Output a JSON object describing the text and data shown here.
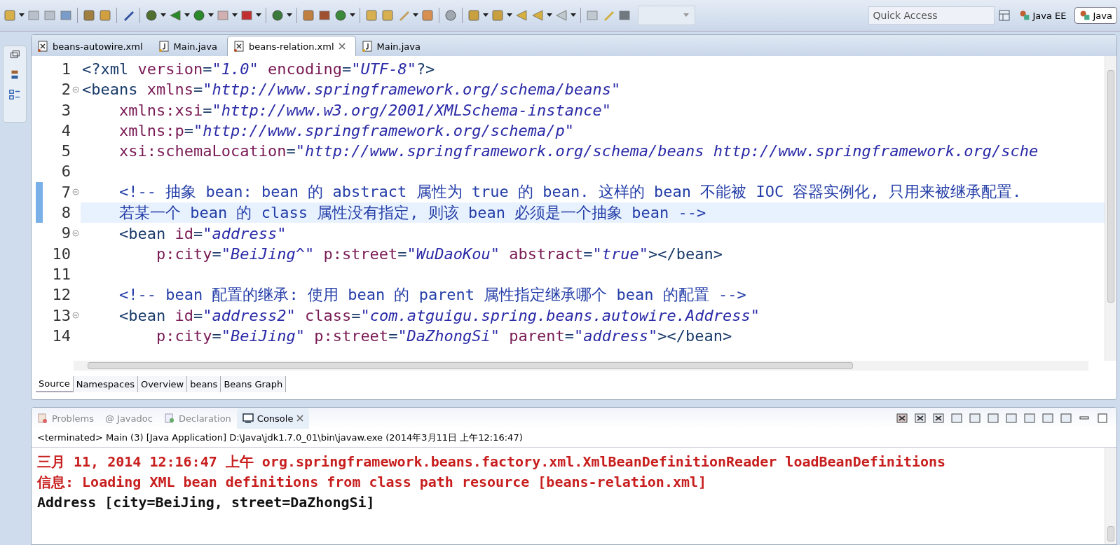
{
  "toolbar": {
    "quick_access": {
      "placeholder": "Quick Access"
    },
    "perspectives": [
      {
        "label": "Java EE",
        "selected": false
      },
      {
        "label": "Java",
        "selected": true
      }
    ]
  },
  "editor_tabs": [
    {
      "label": "beans-autowire.xml",
      "kind": "xml",
      "selected": false,
      "closable": false
    },
    {
      "label": "Main.java",
      "kind": "java",
      "selected": false,
      "closable": false
    },
    {
      "label": "beans-relation.xml",
      "kind": "xml",
      "selected": true,
      "closable": true
    },
    {
      "label": "Main.java",
      "kind": "java",
      "selected": false,
      "closable": false
    }
  ],
  "code_lines": [
    {
      "number": "1",
      "fold": false,
      "marked": false,
      "current": false,
      "tokens": [
        {
          "kind": "tag",
          "text": "<?xml"
        },
        {
          "kind": "attr",
          "text": " version"
        },
        {
          "kind": "tag",
          "text": "="
        },
        {
          "kind": "value",
          "text": "\"1.0\""
        },
        {
          "kind": "attr",
          "text": " encoding"
        },
        {
          "kind": "tag",
          "text": "="
        },
        {
          "kind": "value",
          "text": "\"UTF-8\""
        },
        {
          "kind": "tag",
          "text": "?>"
        }
      ]
    },
    {
      "number": "2",
      "fold": true,
      "marked": false,
      "current": false,
      "tokens": [
        {
          "kind": "tag",
          "text": "<beans"
        },
        {
          "kind": "attr",
          "text": " xmlns"
        },
        {
          "kind": "tag",
          "text": "="
        },
        {
          "kind": "value",
          "text": "\"http://www.springframework.org/schema/beans\""
        }
      ]
    },
    {
      "number": "3",
      "fold": false,
      "marked": false,
      "current": false,
      "tokens": [
        {
          "kind": "attr",
          "text": "    xmlns:xsi"
        },
        {
          "kind": "tag",
          "text": "="
        },
        {
          "kind": "value",
          "text": "\"http://www.w3.org/2001/XMLSchema-instance\""
        }
      ]
    },
    {
      "number": "4",
      "fold": false,
      "marked": false,
      "current": false,
      "tokens": [
        {
          "kind": "attr",
          "text": "    xmlns:p"
        },
        {
          "kind": "tag",
          "text": "="
        },
        {
          "kind": "value",
          "text": "\"http://www.springframework.org/schema/p\""
        }
      ]
    },
    {
      "number": "5",
      "fold": false,
      "marked": false,
      "current": false,
      "tokens": [
        {
          "kind": "attr",
          "text": "    xsi:schemaLocation"
        },
        {
          "kind": "tag",
          "text": "="
        },
        {
          "kind": "value",
          "text": "\"http://www.springframework.org/schema/beans http://www.springframework.org/sche"
        }
      ]
    },
    {
      "number": "6",
      "fold": false,
      "marked": false,
      "current": false
    },
    {
      "number": "7",
      "fold": true,
      "marked": true,
      "current": false,
      "tokens": [
        {
          "kind": "comment",
          "text": "    <!-- 抽象 bean: bean 的 abstract 属性为 true 的 bean. 这样的 bean 不能被 IOC 容器实例化, 只用来被继承配置."
        }
      ]
    },
    {
      "number": "8",
      "fold": false,
      "marked": true,
      "current": true,
      "tokens": [
        {
          "kind": "comment",
          "text": "    若某一个 bean 的 class 属性没有指定, 则该 bean 必须是一个抽象 bean -->"
        }
      ]
    },
    {
      "number": "9",
      "fold": true,
      "marked": false,
      "current": false,
      "tokens": [
        {
          "kind": "tag",
          "text": "    <bean"
        },
        {
          "kind": "attr",
          "text": " id"
        },
        {
          "kind": "tag",
          "text": "="
        },
        {
          "kind": "value",
          "text": "\"address\""
        }
      ]
    },
    {
      "number": "10",
      "fold": false,
      "marked": false,
      "current": false,
      "tokens": [
        {
          "kind": "attr",
          "text": "        p:city"
        },
        {
          "kind": "tag",
          "text": "="
        },
        {
          "kind": "value",
          "text": "\"BeiJing^\""
        },
        {
          "kind": "attr",
          "text": " p:street"
        },
        {
          "kind": "tag",
          "text": "="
        },
        {
          "kind": "value",
          "text": "\"WuDaoKou\""
        },
        {
          "kind": "attr",
          "text": " abstract"
        },
        {
          "kind": "tag",
          "text": "="
        },
        {
          "kind": "value",
          "text": "\"true\""
        },
        {
          "kind": "tag",
          "text": "></bean>"
        }
      ]
    },
    {
      "number": "11",
      "fold": false,
      "marked": false,
      "current": false
    },
    {
      "number": "12",
      "fold": false,
      "marked": false,
      "current": false,
      "tokens": [
        {
          "kind": "comment",
          "text": "    <!-- bean 配置的继承: 使用 bean 的 parent 属性指定继承哪个 bean 的配置 -->"
        }
      ]
    },
    {
      "number": "13",
      "fold": true,
      "marked": false,
      "current": false,
      "tokens": [
        {
          "kind": "tag",
          "text": "    <bean"
        },
        {
          "kind": "attr",
          "text": " id"
        },
        {
          "kind": "tag",
          "text": "="
        },
        {
          "kind": "value",
          "text": "\"address2\""
        },
        {
          "kind": "attr",
          "text": " class"
        },
        {
          "kind": "tag",
          "text": "="
        },
        {
          "kind": "value",
          "text": "\"com.atguigu.spring.beans.autowire.Address\""
        }
      ]
    },
    {
      "number": "14",
      "fold": false,
      "marked": false,
      "current": false,
      "tokens": [
        {
          "kind": "attr",
          "text": "        p:city"
        },
        {
          "kind": "tag",
          "text": "="
        },
        {
          "kind": "value",
          "text": "\"BeiJing\""
        },
        {
          "kind": "attr",
          "text": " p:street"
        },
        {
          "kind": "tag",
          "text": "="
        },
        {
          "kind": "value",
          "text": "\"DaZhongSi\""
        },
        {
          "kind": "attr",
          "text": " parent"
        },
        {
          "kind": "tag",
          "text": "="
        },
        {
          "kind": "value",
          "text": "\"address\""
        },
        {
          "kind": "tag",
          "text": "></bean>"
        }
      ]
    }
  ],
  "page_tabs": [
    {
      "label": "Source",
      "selected": true
    },
    {
      "label": "Namespaces",
      "selected": false
    },
    {
      "label": "Overview",
      "selected": false
    },
    {
      "label": "beans",
      "selected": false
    },
    {
      "label": "Beans Graph",
      "selected": false
    }
  ],
  "view_tabs": [
    {
      "label": "Problems",
      "kind": "problems",
      "selected": false
    },
    {
      "label": "@ Javadoc",
      "kind": "javadoc",
      "selected": false
    },
    {
      "label": "Declaration",
      "kind": "declaration",
      "selected": false
    },
    {
      "label": "Console",
      "kind": "console",
      "selected": true
    }
  ],
  "console": {
    "header": "<terminated> Main (3) [Java Application] D:\\Java\\jdk1.7.0_01\\bin\\javaw.exe (2014年3月11日 上午12:16:47)",
    "lines": [
      {
        "kind": "err",
        "text": "三月 11, 2014 12:16:47 上午 org.springframework.beans.factory.xml.XmlBeanDefinitionReader loadBeanDefinitions"
      },
      {
        "kind": "err",
        "text": "信息: Loading XML bean definitions from class path resource [beans-relation.xml]"
      },
      {
        "kind": "out",
        "text": "Address [city=BeiJing, street=DaZhongSi]"
      }
    ]
  }
}
